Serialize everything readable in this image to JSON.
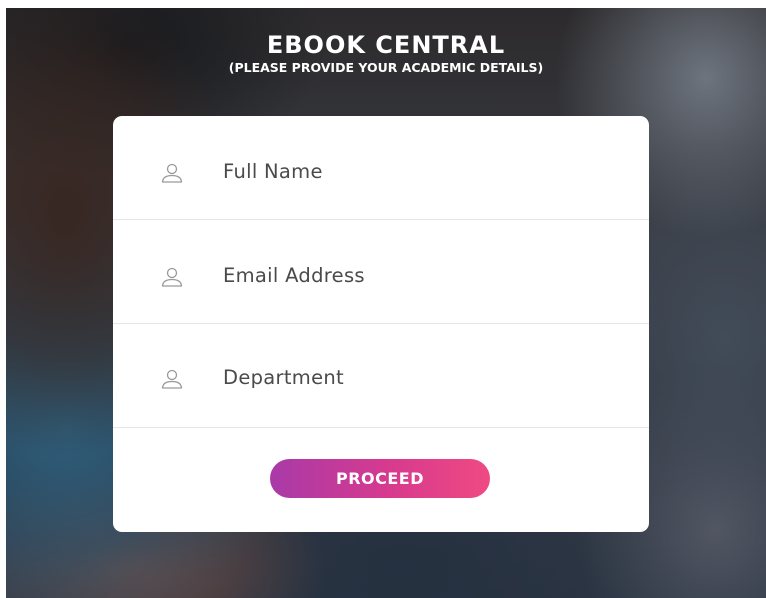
{
  "header": {
    "title": "EBOOK CENTRAL",
    "subtitle": "(PLEASE PROVIDE YOUR ACADEMIC DETAILS)"
  },
  "form": {
    "fields": [
      {
        "icon": "user-icon",
        "placeholder": "Full Name"
      },
      {
        "icon": "user-icon",
        "placeholder": "Email Address"
      },
      {
        "icon": "user-icon",
        "placeholder": "Department"
      }
    ],
    "submit_label": "PROCEED"
  },
  "colors": {
    "button_gradient_start": "#a83aa8",
    "button_gradient_end": "#ef4a82",
    "card_background": "#ffffff",
    "field_text": "#4a4a4a",
    "icon_stroke": "#9a9a9a"
  }
}
